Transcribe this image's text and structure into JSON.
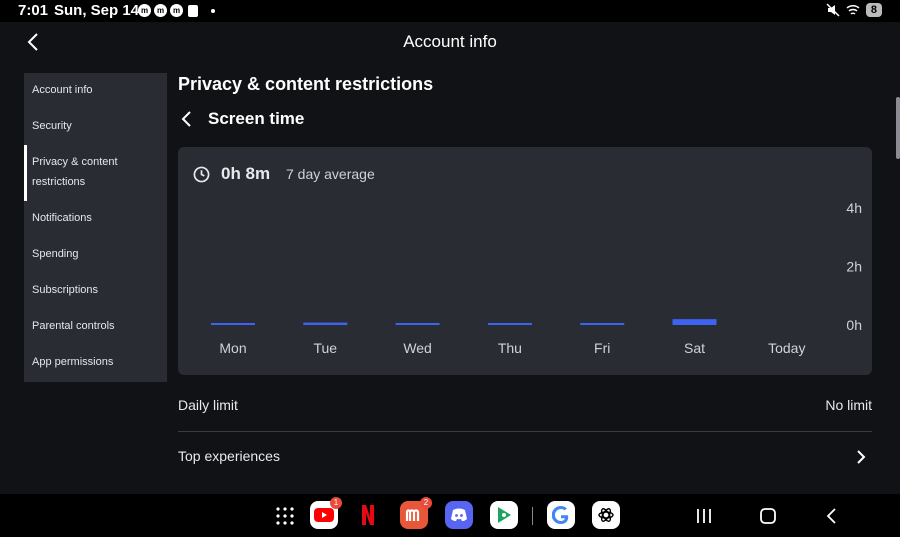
{
  "status_bar": {
    "time": "7:01",
    "date": "Sun, Sep 14",
    "battery": "8",
    "app_icons": [
      "m",
      "m",
      "m"
    ]
  },
  "header": {
    "title": "Account info"
  },
  "sidebar": {
    "items": [
      {
        "label": "Account info"
      },
      {
        "label": "Security"
      },
      {
        "label": "Privacy & content restrictions",
        "active": true
      },
      {
        "label": "Notifications"
      },
      {
        "label": "Spending"
      },
      {
        "label": "Subscriptions"
      },
      {
        "label": "Parental controls"
      },
      {
        "label": "App permissions"
      }
    ]
  },
  "main": {
    "title": "Privacy & content restrictions",
    "subtitle": "Screen time",
    "summary": {
      "value": "0h 8m",
      "label": "7 day average"
    },
    "rows": {
      "daily_limit_label": "Daily limit",
      "daily_limit_value": "No limit",
      "top_experiences_label": "Top experiences"
    }
  },
  "chart_data": {
    "type": "bar",
    "categories": [
      "Mon",
      "Tue",
      "Wed",
      "Thu",
      "Fri",
      "Sat",
      "Today"
    ],
    "values": [
      2,
      5,
      3,
      3,
      1,
      12,
      0
    ],
    "unit": "minutes",
    "y_ticks": [
      "4h",
      "2h",
      "0h"
    ],
    "ylim": [
      0,
      240
    ],
    "bar_color": "#3d63f2"
  },
  "navbar": {
    "apps": [
      {
        "name": "youtube",
        "badge": "1"
      },
      {
        "name": "netflix",
        "badge": ""
      },
      {
        "name": "manga",
        "badge": "2"
      },
      {
        "name": "discord",
        "badge": ""
      },
      {
        "name": "play-games",
        "badge": ""
      },
      {
        "name": "google",
        "badge": ""
      },
      {
        "name": "chatgpt",
        "badge": ""
      }
    ]
  },
  "colors": {
    "background": "#111216",
    "card": "#2a2c33",
    "accent": "#3d63f2"
  }
}
